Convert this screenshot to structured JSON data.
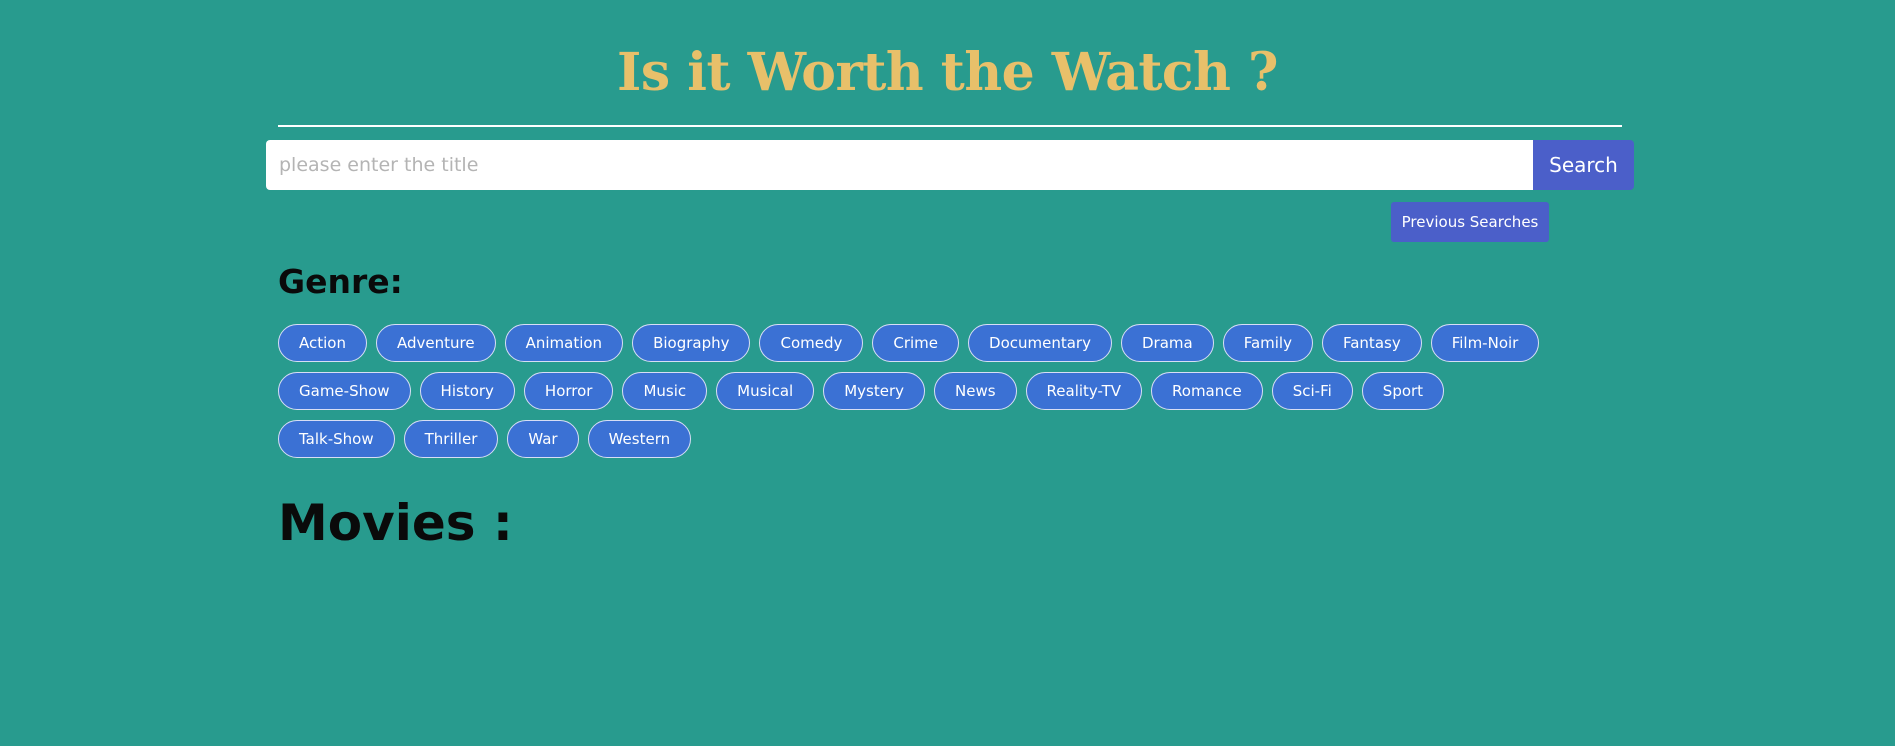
{
  "header": {
    "title": "Is it Worth the Watch ?"
  },
  "search": {
    "placeholder": "please enter the title",
    "value": "",
    "button_label": "Search",
    "previous_label": "Previous Searches"
  },
  "genres": {
    "heading": "Genre:",
    "items": [
      "Action",
      "Adventure",
      "Animation",
      "Biography",
      "Comedy",
      "Crime",
      "Documentary",
      "Drama",
      "Family",
      "Fantasy",
      "Film-Noir",
      "Game-Show",
      "History",
      "Horror",
      "Music",
      "Musical",
      "Mystery",
      "News",
      "Reality-TV",
      "Romance",
      "Sci-Fi",
      "Sport",
      "Talk-Show",
      "Thriller",
      "War",
      "Western"
    ]
  },
  "movies": {
    "heading": "Movies :"
  },
  "colors": {
    "background": "#289b8e",
    "title": "#e8c06a",
    "button": "#4b5fc9",
    "genre_pill": "#3b71d4"
  }
}
